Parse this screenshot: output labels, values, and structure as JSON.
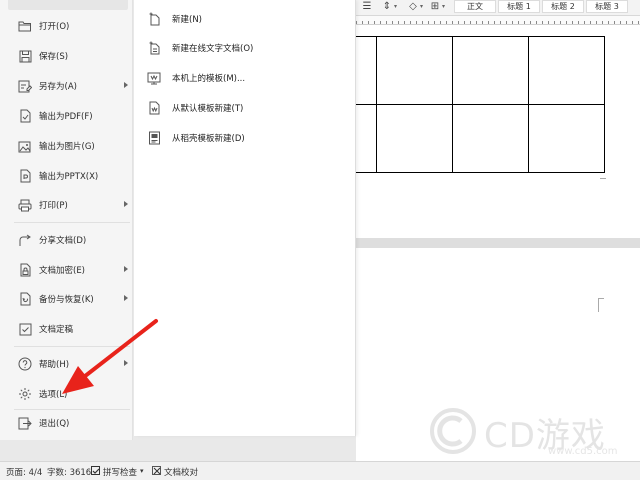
{
  "ribbon": {
    "styles": [
      "正文",
      "标题 1",
      "标题 2",
      "标题 3"
    ]
  },
  "file_menu": {
    "items": [
      {
        "label": "打开(O)",
        "icon": "folder-open-icon",
        "arrow": false
      },
      {
        "label": "保存(S)",
        "icon": "save-icon",
        "arrow": false
      },
      {
        "label": "另存为(A)",
        "icon": "save-as-icon",
        "arrow": true
      },
      {
        "label": "输出为PDF(F)",
        "icon": "export-pdf-icon",
        "arrow": false
      },
      {
        "label": "输出为图片(G)",
        "icon": "export-image-icon",
        "arrow": false
      },
      {
        "label": "输出为PPTX(X)",
        "icon": "export-pptx-icon",
        "arrow": false
      },
      {
        "label": "打印(P)",
        "icon": "print-icon",
        "arrow": true
      },
      {
        "label": "分享文档(D)",
        "icon": "share-icon",
        "arrow": false
      },
      {
        "label": "文档加密(E)",
        "icon": "encrypt-icon",
        "arrow": true
      },
      {
        "label": "备份与恢复(K)",
        "icon": "backup-icon",
        "arrow": true
      },
      {
        "label": "文档定稿",
        "icon": "finalize-icon",
        "arrow": false
      },
      {
        "label": "帮助(H)",
        "icon": "help-icon",
        "arrow": true
      },
      {
        "label": "选项(L)",
        "icon": "gear-icon",
        "arrow": false
      },
      {
        "label": "退出(Q)",
        "icon": "exit-icon",
        "arrow": false
      }
    ]
  },
  "new_submenu": {
    "items": [
      {
        "label": "新建(N)",
        "icon": "new-doc-icon"
      },
      {
        "label": "新建在线文字文档(O)",
        "icon": "new-online-doc-icon"
      },
      {
        "label": "本机上的模板(M)...",
        "icon": "local-template-icon"
      },
      {
        "label": "从默认模板新建(T)",
        "icon": "default-template-icon"
      },
      {
        "label": "从稻壳模板新建(D)",
        "icon": "docer-template-icon"
      }
    ]
  },
  "status_bar": {
    "page": "页面: 4/4",
    "word_count": "字数: 3616",
    "spell_check": "拼写检查",
    "proofread": "文档校对"
  },
  "watermark": {
    "brand": "CD游戏",
    "url": "www.cd5.com"
  },
  "colors": {
    "arrow": "#e8231b",
    "menu_bg": "#f5f5f5",
    "submenu_bg": "#ffffff"
  }
}
